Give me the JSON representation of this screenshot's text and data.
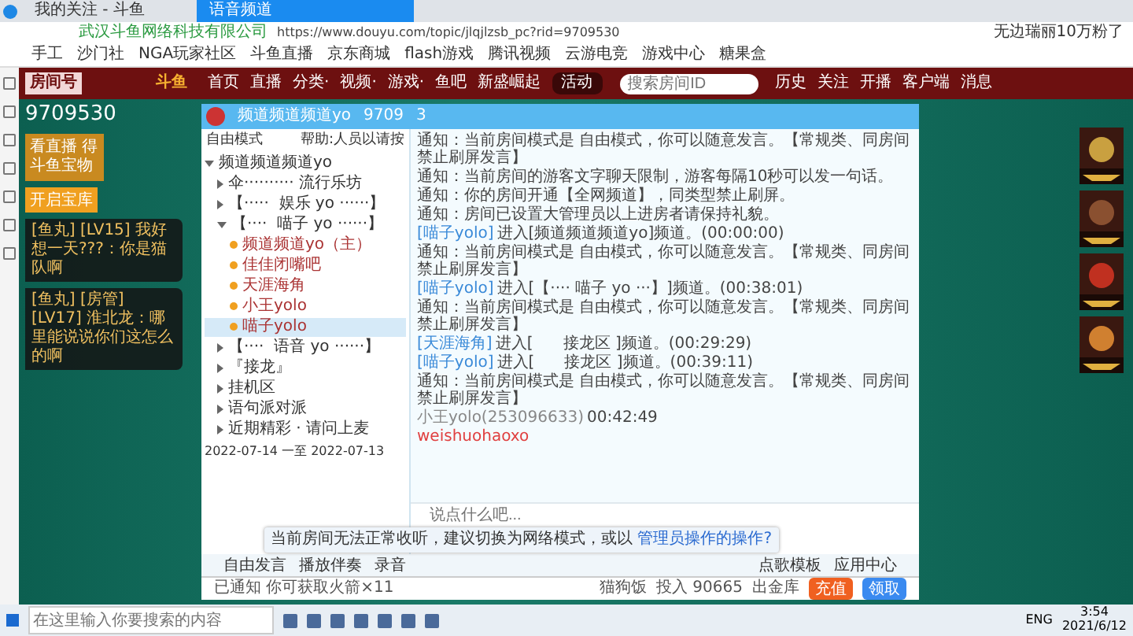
{
  "browser": {
    "tabs": [
      {
        "label": "我的关注 - 斗鱼",
        "selected": false
      },
      {
        "label": "语音频道",
        "selected": true
      }
    ],
    "address": "https://www.douyu.com/topic/jlqjlzsb_pc?rid=9709530",
    "site_note": "武汉斗鱼网络科技有限公司",
    "profile": "无边瑞丽10万粉了",
    "bookmarks": [
      "手工",
      "沙门社",
      "NGA玩家社区",
      "斗鱼直播",
      "京东商城",
      "flash游戏",
      "腾讯视频",
      "云游电竞",
      "游戏中心",
      "糖果盒"
    ]
  },
  "site_nav": {
    "logo": "斗鱼",
    "items": [
      "首页",
      "直播",
      "分类·",
      "视频·",
      "游戏·",
      "鱼吧",
      "新盛崛起"
    ],
    "badge": "活动",
    "search": {
      "placeholder": "搜索房间ID"
    },
    "icons": [
      "历史",
      "关注",
      "开播",
      "客户端",
      "消息"
    ]
  },
  "room": {
    "label": "房间号",
    "number": "9709530",
    "left_banner": "看直播 得斗鱼宝物",
    "left_button": "开启宝库"
  },
  "danmaku": [
    {
      "text": "[鱼丸]  [LV15] 我好想一天???：你是猫队啊"
    },
    {
      "text": "[鱼丸]  [房管]  [LV17] 淮北龙：哪里能说说你们这怎么的啊"
    }
  ],
  "voice": {
    "header": {
      "name": "频道频道频道yo",
      "id": "9709",
      "count": "3"
    },
    "mode": "自由模式",
    "mode_hint": "帮助:人员以请按",
    "tree": [
      {
        "label": "频道频道频道yo",
        "expanded": true,
        "children": [
          {
            "label": "伞·········· 流行乐坊",
            "expanded": false
          },
          {
            "label": "【·····  娱乐 yo ······】",
            "expanded": false
          },
          {
            "label": "【····  喵子 yo ······】",
            "expanded": true,
            "children": [
              {
                "label": "频道频道yo（主）",
                "selected": false
              },
              {
                "label": "佳佳闭嘴吧",
                "selected": false
              },
              {
                "label": "天涯海角",
                "selected": false
              },
              {
                "label": "小王yolo",
                "selected": false
              },
              {
                "label": "喵子yolo",
                "selected": true
              }
            ]
          },
          {
            "label": "【····  语音 yo ······】",
            "expanded": false
          },
          {
            "label": "『接龙』",
            "expanded": false
          },
          {
            "label": "挂机区",
            "expanded": false
          },
          {
            "label": "语句派对派",
            "expanded": false
          },
          {
            "label": "近期精彩 · 请问上麦",
            "expanded": false
          }
        ]
      }
    ],
    "footer": "2022-07-14 一至 2022-07-13",
    "messages": [
      {
        "kind": "notice",
        "text": "通知：当前房间模式是 自由模式，你可以随意发言。【常规类、同房间禁止刷屏发言】"
      },
      {
        "kind": "notice",
        "text": "通知：当前房间的游客文字聊天限制，游客每隔10秒可以发一句话。"
      },
      {
        "kind": "notice",
        "text": "通知：你的房间开通【全网频道】，同类型禁止刷屏。"
      },
      {
        "kind": "notice",
        "text": "通知：房间已设置大管理员以上进房者请保持礼貌。"
      },
      {
        "kind": "join",
        "name": "[喵子yolo]",
        "text": "进入[频道频道频道yo]频道。(00:00:00)"
      },
      {
        "kind": "notice",
        "text": "通知：当前房间模式是 自由模式，你可以随意发言。【常规类、同房间禁止刷屏发言】"
      },
      {
        "kind": "join",
        "name": "[喵子yolo]",
        "text": "进入[【···· 喵子 yo ···】]频道。(00:38:01)"
      },
      {
        "kind": "notice",
        "text": "通知：当前房间模式是 自由模式，你可以随意发言。【常规类、同房间禁止刷屏发言】"
      },
      {
        "kind": "join",
        "name": "[天涯海角]",
        "text": "进入[      接龙区 ]频道。(00:29:29)"
      },
      {
        "kind": "join",
        "name": "[喵子yolo]",
        "text": "进入[      接龙区 ]频道。(00:39:11)"
      },
      {
        "kind": "notice",
        "text": "通知：当前房间模式是 自由模式，你可以随意发言。【常规类、同房间禁止刷屏发言】"
      },
      {
        "kind": "chat",
        "name": "小王yolo(253096633)",
        "time": "00:42:49",
        "text": "weishuohaoxo"
      }
    ],
    "input": {
      "placeholder": "说点什么吧..."
    },
    "tip": {
      "text": "当前房间无法正常收听，建议切换为网络模式，或以",
      "link": "管理员操作的操作?"
    },
    "toolbar": [
      "自由发言",
      "播放伴奏",
      "录音"
    ],
    "toolbar_right": [
      "点歌模板",
      "应用中心"
    ]
  },
  "page_bar": {
    "text": "已通知 你可获取火箭×11",
    "items": [
      "猫狗饭",
      "投入 90665",
      "出金库"
    ],
    "buttons": [
      "充值",
      "领取"
    ]
  },
  "taskbar": {
    "search": {
      "placeholder": "在这里输入你要搜索的内容"
    },
    "lang": "ENG",
    "time": "3:54",
    "date": "2021/6/12"
  }
}
